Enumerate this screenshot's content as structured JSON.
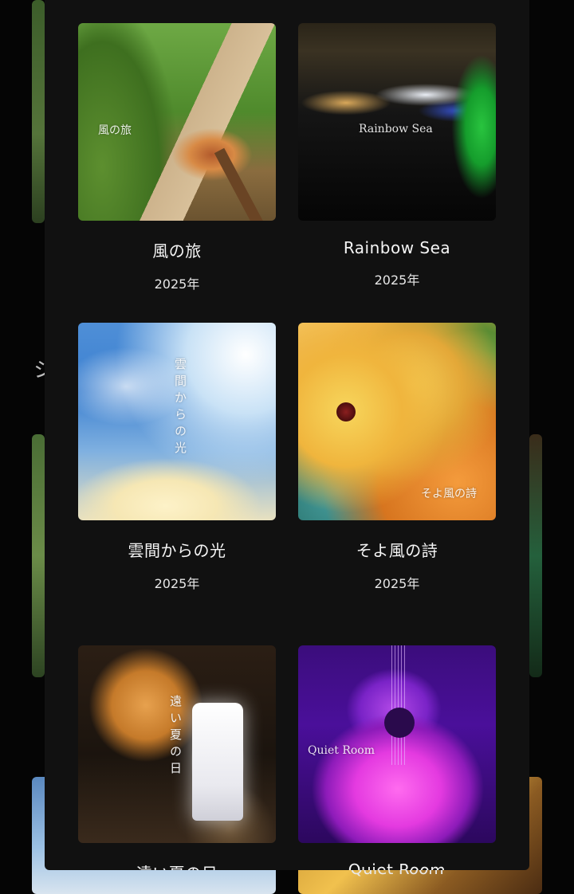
{
  "background_page": {
    "section_heading_fragment": "シ",
    "partial_caption": "Quiet Room"
  },
  "albums": [
    {
      "title": "風の旅",
      "year": "2025年",
      "cover_text": "風の旅",
      "cover_style": "horizontal"
    },
    {
      "title": "Rainbow Sea",
      "year": "2025年",
      "cover_text": "Rainbow Sea",
      "cover_style": "horizontal"
    },
    {
      "title": "雲間からの光",
      "year": "2025年",
      "cover_text": "雲間からの光",
      "cover_style": "vertical"
    },
    {
      "title": "そよ風の詩",
      "year": "2025年",
      "cover_text": "そよ風の詩",
      "cover_style": "horizontal"
    },
    {
      "title": "遠い夏の日",
      "year": "",
      "cover_text": "遠い夏の日",
      "cover_style": "vertical"
    },
    {
      "title": "Quiet Room",
      "year": "",
      "cover_text": "Quiet Room",
      "cover_style": "horizontal"
    }
  ],
  "colors": {
    "page_background": "#050505",
    "modal_background": "#111111",
    "text_primary": "#f5f5f5"
  }
}
